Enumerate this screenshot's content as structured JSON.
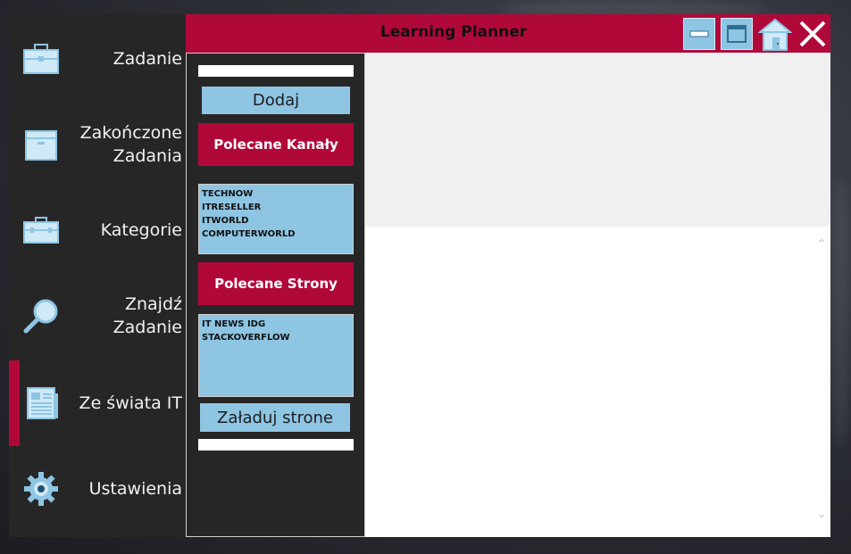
{
  "window": {
    "title": "Learning Planner",
    "controls": [
      {
        "name": "minimize",
        "icon": "minimize-icon"
      },
      {
        "name": "maximize",
        "icon": "maximize-icon"
      },
      {
        "name": "home",
        "icon": "home-icon"
      },
      {
        "name": "close",
        "icon": "close-icon"
      }
    ]
  },
  "sidebar": {
    "items": [
      {
        "label": "Zadanie",
        "icon": "briefcase-icon",
        "active": false
      },
      {
        "label": "Zakończone Zadania",
        "icon": "archive-box-icon",
        "active": false
      },
      {
        "label": "Kategorie",
        "icon": "toolbox-icon",
        "active": false
      },
      {
        "label": "Znajdź Zadanie",
        "icon": "magnifier-icon",
        "active": false
      },
      {
        "label": "Ze świata IT",
        "icon": "newspaper-icon",
        "active": true
      },
      {
        "label": "Ustawienia",
        "icon": "gear-icon",
        "active": false
      }
    ]
  },
  "panel": {
    "add_label": "Dodaj",
    "channels_label": "Polecane Kanały",
    "channels": [
      "TECHNOW",
      "ITRESELLER",
      "ITWORLD",
      "COMPUTERWORLD"
    ],
    "sites_label": "Polecane Strony",
    "sites": [
      "IT NEWS IDG",
      "STACKOVERFLOW"
    ],
    "load_label": "Załaduj strone"
  },
  "colors": {
    "accent": "#b1083a",
    "light_blue": "#8ec5e3",
    "sidebar_bg": "#272627"
  }
}
